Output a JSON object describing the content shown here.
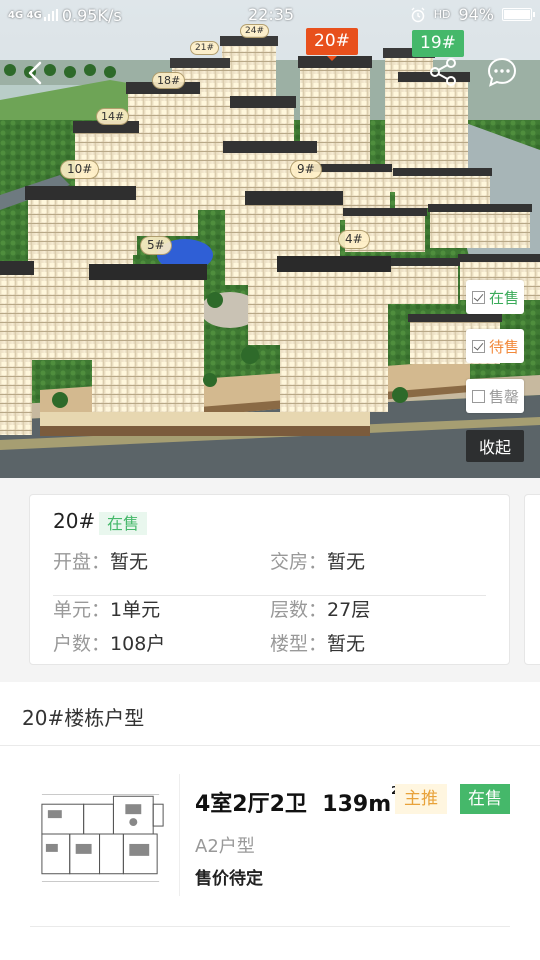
{
  "status_bar": {
    "network": "4G 4G",
    "speed": "0.95K/s",
    "time": "22:35",
    "hd": "HD",
    "battery": "94%"
  },
  "hero": {
    "icons": {
      "back": "back-arrow-icon",
      "share": "share-icon",
      "chat": "chat-icon",
      "alarm": "alarm-icon"
    },
    "building_tags": [
      "20#",
      "19#",
      "21#",
      "24#",
      "18#",
      "14#",
      "10#",
      "9#",
      "5#",
      "4#"
    ],
    "filters": [
      {
        "label": "在售",
        "checked": true,
        "color": "#3bab5a"
      },
      {
        "label": "待售",
        "checked": true,
        "color": "#f2893b"
      },
      {
        "label": "售罄",
        "checked": false,
        "color": "#999999"
      }
    ],
    "collapse_label": "收起"
  },
  "building": {
    "name": "20#",
    "status": "在售",
    "open_label": "开盘：",
    "open_value": "暂无",
    "delivery_label": "交房：",
    "delivery_value": "暂无",
    "unit_label": "单元：",
    "unit_value": "1单元",
    "floors_label": "层数：",
    "floors_value": "27层",
    "households_label": "户数：",
    "households_value": "108户",
    "type_label": "楼型：",
    "type_value": "暂无"
  },
  "units_section": {
    "title": "20#楼栋户型",
    "items": [
      {
        "layout": "4室2厅2卫",
        "area": "139m",
        "area_sup": "2",
        "tag_recommend": "主推",
        "tag_status": "在售",
        "name": "A2户型",
        "price": "售价待定"
      }
    ]
  },
  "colors": {
    "accent_green": "#45b86a",
    "selected_orange": "#e8501c",
    "pending_orange": "#f2893b"
  }
}
